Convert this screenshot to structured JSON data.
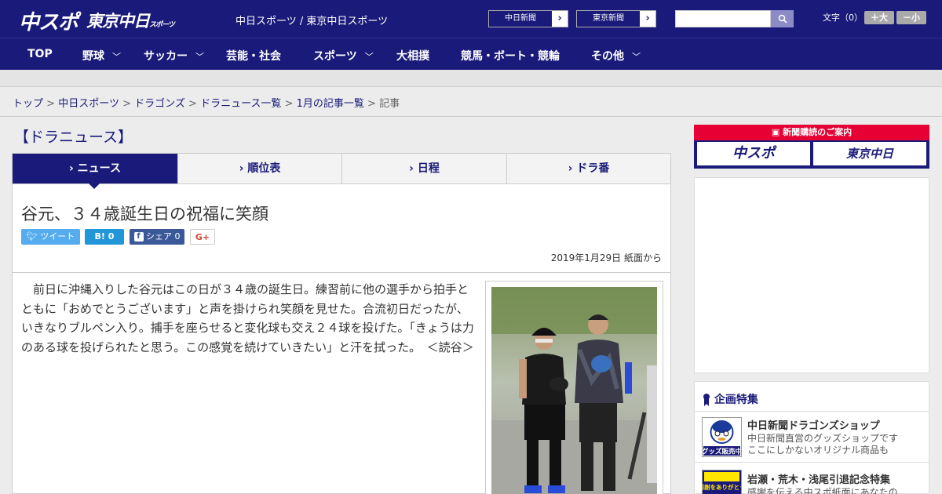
{
  "header": {
    "logo_chunichi_sports": "中スポ",
    "logo_tokyo_chunichi": "東京中日",
    "logo_tokyo_chunichi_suffix": "スポーツ",
    "site_names": "中日スポーツ / 東京中日スポーツ",
    "paper_links": [
      {
        "label": "中日新聞",
        "arrow": "›"
      },
      {
        "label": "東京新聞",
        "arrow": "›"
      }
    ],
    "search_value": "",
    "text_size_label": "文字（0）",
    "text_size_up": "＋大",
    "text_size_down": "－小"
  },
  "nav": {
    "items": [
      {
        "label": "TOP",
        "has_dropdown": false
      },
      {
        "label": "野球",
        "has_dropdown": true
      },
      {
        "label": "サッカー",
        "has_dropdown": true
      },
      {
        "label": "芸能・社会",
        "has_dropdown": false
      },
      {
        "label": "スポーツ",
        "has_dropdown": true
      },
      {
        "label": "大相撲",
        "has_dropdown": false
      },
      {
        "label": "競馬・ボート・競輪",
        "has_dropdown": false
      },
      {
        "label": "その他",
        "has_dropdown": true
      }
    ]
  },
  "breadcrumb": {
    "links": [
      "トップ",
      "中日スポーツ",
      "ドラゴンズ",
      "ドラニュース一覧",
      "1月の記事一覧"
    ],
    "current": "記事",
    "separator": ">"
  },
  "section_title": "【ドラニュース】",
  "tabs": [
    {
      "label": "› ニュース",
      "active": true
    },
    {
      "label": "› 順位表",
      "active": false
    },
    {
      "label": "› 日程",
      "active": false
    },
    {
      "label": "› ドラ番",
      "active": false
    }
  ],
  "article": {
    "headline": "谷元、３４歳誕生日の祝福に笑顔",
    "share": {
      "tweet": "ツイート",
      "hatena": "B!  0",
      "facebook": "シェア 0",
      "google_plus": "G+"
    },
    "dateline": "2019年1月29日 紙面から",
    "body": "　前日に沖縄入りした谷元はこの日が３４歳の誕生日。練習前に他の選手から拍手とともに「おめでとうございます」と声を掛けられ笑顔を見せた。合流初日だったが、いきなりブルペン入り。捕手を座らせると変化球も交え２４球を投げた。「きょうは力のある球を投げられたと思う。この感覚を続けていきたい」と汗を拭った。　＜読谷＞"
  },
  "sidebar": {
    "subscription_banner": "新聞購読のご案内",
    "sub_logo_1": "中スポ",
    "sub_logo_2": "東京中日",
    "promo_title": "企画特集",
    "promos": [
      {
        "name": "中日新聞ドラゴンズショップ",
        "desc_1": "中日新聞直営のグッズショップです",
        "desc_2": "ここにしかないオリジナル商品も",
        "thumb_text": "グッズ販売中"
      },
      {
        "name": "岩瀬・荒木・浅尾引退記念特集",
        "desc_1": "感謝を伝える中スポ紙面にあなたの",
        "thumb_text": "感謝をありがとう"
      }
    ]
  },
  "colors": {
    "brand_navy": "#1a1a7a",
    "accent_red": "#e60033",
    "twitter": "#55acee",
    "hatena": "#2196d9",
    "facebook": "#3b5998"
  }
}
